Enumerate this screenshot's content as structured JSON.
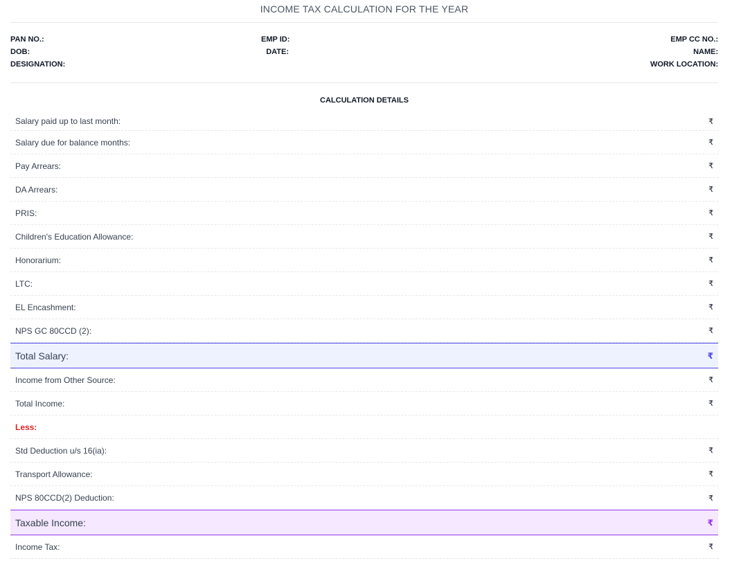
{
  "document": {
    "title": "INCOME TAX CALCULATION FOR THE YEAR"
  },
  "info": {
    "left": [
      "PAN NO.:",
      "DOB:",
      "DESIGNATION:"
    ],
    "middle": [
      "EMP ID:",
      "DATE:"
    ],
    "right": [
      "EMP CC NO.:",
      "NAME:",
      "WORK LOCATION:"
    ]
  },
  "calculation": {
    "heading": "CALCULATION DETAILS",
    "currency_symbol": "₹",
    "rows": [
      {
        "label": "Salary paid up to last month:",
        "value": "₹"
      },
      {
        "label": "Salary due for balance months:",
        "value": "₹"
      },
      {
        "label": "Pay Arrears:",
        "value": "₹"
      },
      {
        "label": "DA Arrears:",
        "value": "₹"
      },
      {
        "label": "PRIS:",
        "value": "₹"
      },
      {
        "label": "Children's Education Allowance:",
        "value": "₹"
      },
      {
        "label": "Honorarium:",
        "value": "₹"
      },
      {
        "label": "LTC:",
        "value": "₹"
      },
      {
        "label": "EL Encashment:",
        "value": "₹"
      },
      {
        "label": "NPS GC 80CCD (2):",
        "value": "₹"
      },
      {
        "label": "Total Salary:",
        "value": "₹"
      },
      {
        "label": "Income from Other Source:",
        "value": "₹"
      },
      {
        "label": "Total Income:",
        "value": "₹"
      },
      {
        "label": "Less:",
        "value": ""
      },
      {
        "label": "Std Deduction u/s 16(ia):",
        "value": "₹"
      },
      {
        "label": "Transport Allowance:",
        "value": "₹"
      },
      {
        "label": "NPS 80CCD(2) Deduction:",
        "value": "₹"
      },
      {
        "label": "Taxable Income:",
        "value": "₹"
      },
      {
        "label": "Income Tax:",
        "value": "₹"
      }
    ]
  },
  "colors": {
    "total_salary_accent": "#4f46e5",
    "total_salary_bg": "#eef2ff",
    "taxable_accent": "#9333ea",
    "taxable_bg": "#f5e8ff",
    "less_label": "#dc2626"
  }
}
